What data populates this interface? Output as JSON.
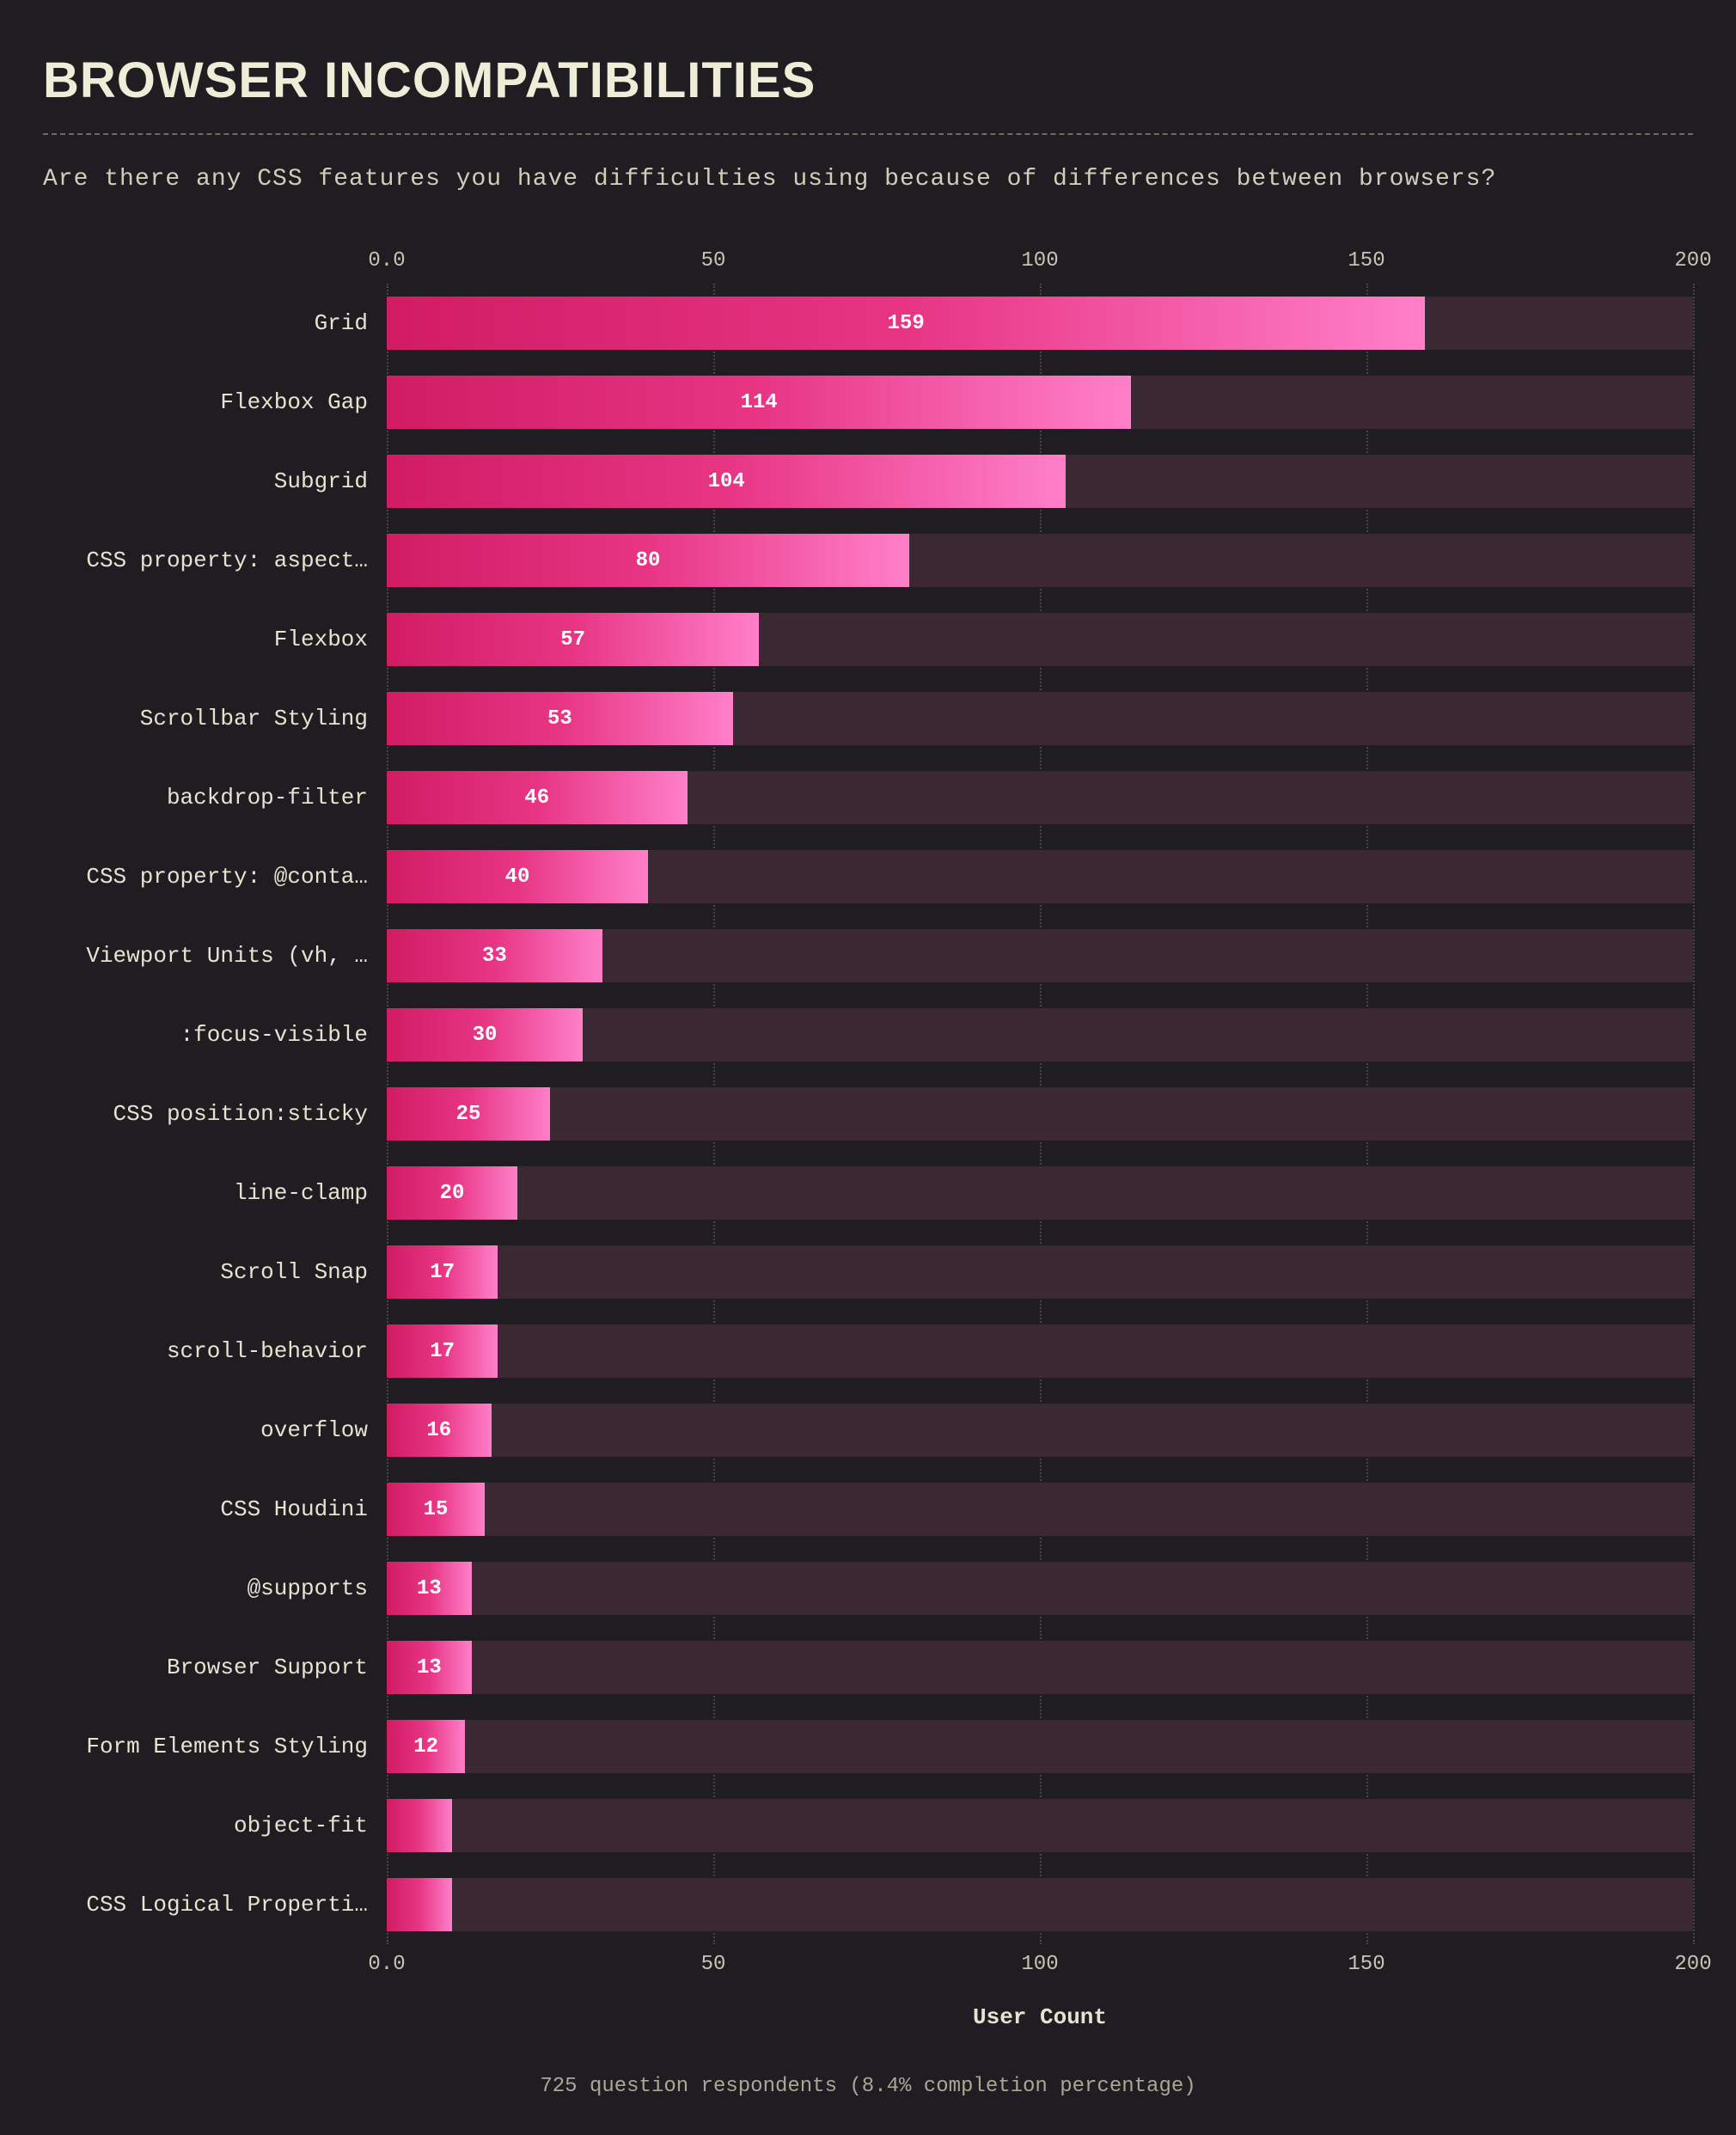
{
  "title": "BROWSER INCOMPATIBILITIES",
  "subtitle": "Are there any CSS features you have difficulties using because of differences between browsers?",
  "footer": "725 question respondents (8.4% completion percentage)",
  "xlabel": "User Count",
  "chart_data": {
    "type": "bar",
    "xlabel": "User Count",
    "xlim": [
      0,
      200
    ],
    "ticks": [
      0.0,
      50,
      100,
      150,
      200
    ],
    "tick_labels": [
      "0.0",
      "50",
      "100",
      "150",
      "200"
    ],
    "categories": [
      "Grid",
      "Flexbox Gap",
      "Subgrid",
      "CSS property: aspect…",
      "Flexbox",
      "Scrollbar Styling",
      "backdrop-filter",
      "CSS property: @conta…",
      "Viewport Units (vh, …",
      ":focus-visible",
      "CSS position:sticky",
      "line-clamp",
      "Scroll Snap",
      "scroll-behavior",
      "overflow",
      "CSS Houdini",
      "@supports",
      "Browser Support",
      "Form Elements Styling",
      "object-fit",
      "CSS Logical Properti…"
    ],
    "values": [
      159,
      114,
      104,
      80,
      57,
      53,
      46,
      40,
      33,
      30,
      25,
      20,
      17,
      17,
      16,
      15,
      13,
      13,
      12,
      10,
      10
    ],
    "show_value_label": [
      true,
      true,
      true,
      true,
      true,
      true,
      true,
      true,
      true,
      true,
      true,
      true,
      true,
      true,
      true,
      true,
      true,
      true,
      true,
      false,
      false
    ]
  }
}
